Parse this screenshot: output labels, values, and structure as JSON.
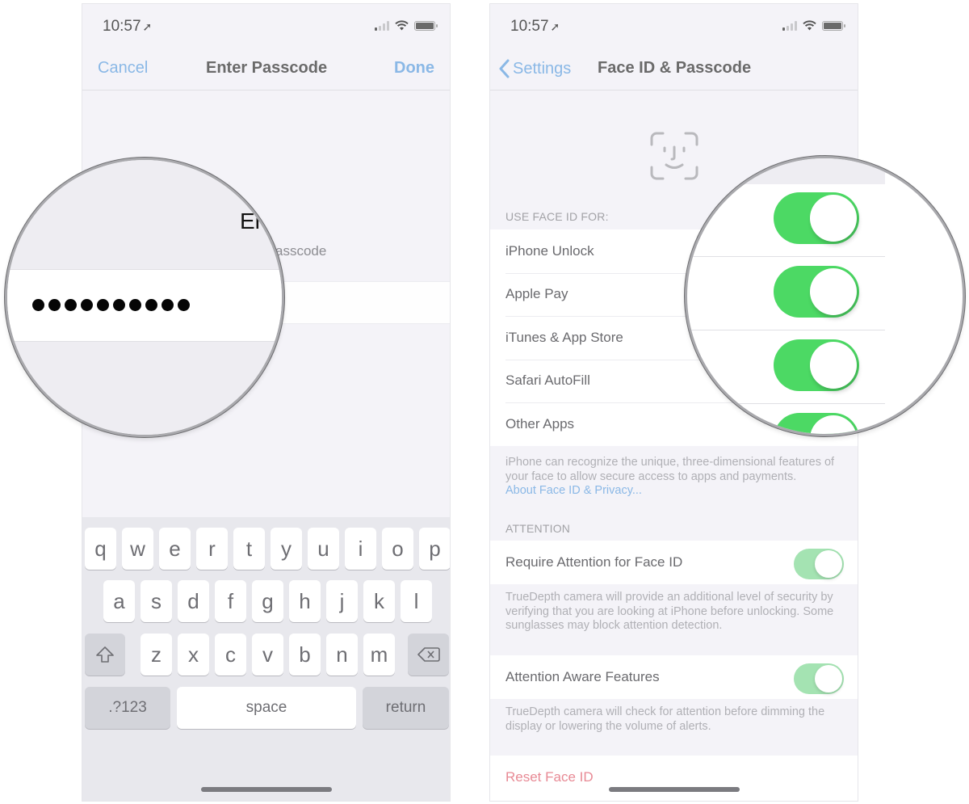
{
  "left_screen": {
    "status": {
      "time": "10:57",
      "location_icon": "location-arrow-icon",
      "signal_bars_on": 1,
      "signal_bars_total": 4,
      "wifi_icon": "wifi-icon",
      "battery_icon": "battery-icon"
    },
    "nav": {
      "cancel_label": "Cancel",
      "title": "Enter Passcode",
      "done_label": "Done"
    },
    "magnified_title_fragment": "Er",
    "passcode_hint_fragment": "asscode",
    "passcode_dots": 10,
    "keyboard": {
      "row1": [
        "q",
        "w",
        "e",
        "r",
        "t",
        "y",
        "u",
        "i",
        "o",
        "p"
      ],
      "row2": [
        "a",
        "s",
        "d",
        "f",
        "g",
        "h",
        "j",
        "k",
        "l"
      ],
      "row3": [
        "z",
        "x",
        "c",
        "v",
        "b",
        "n",
        "m"
      ],
      "shift_icon": "shift-icon",
      "delete_icon": "delete-backspace-icon",
      "numbers_label": ".?123",
      "space_label": "space",
      "return_label": "return"
    }
  },
  "right_screen": {
    "status": {
      "time": "10:57",
      "location_icon": "location-arrow-icon",
      "signal_bars_on": 1,
      "signal_bars_total": 4,
      "wifi_icon": "wifi-icon",
      "battery_icon": "battery-icon"
    },
    "nav": {
      "back_label": "Settings",
      "title": "Face ID & Passcode"
    },
    "faceid_icon": "face-id-icon",
    "use_face_id_header": "USE FACE ID FOR:",
    "use_face_id_items": [
      {
        "label": "iPhone Unlock",
        "enabled": true
      },
      {
        "label": "Apple Pay",
        "enabled": true
      },
      {
        "label": "iTunes & App Store",
        "enabled": true
      },
      {
        "label": "Safari AutoFill",
        "enabled": true
      },
      {
        "label": "Other Apps",
        "enabled": true
      }
    ],
    "face_id_footer": "iPhone can recognize the unique, three-dimensional features of your face to allow secure access to apps and payments.",
    "face_id_footer_link": "About Face ID & Privacy...",
    "attention_header": "ATTENTION",
    "require_attention": {
      "label": "Require Attention for Face ID",
      "enabled": true
    },
    "require_attention_footer": "TrueDepth camera will provide an additional level of security by verifying that you are looking at iPhone before unlocking. Some sunglasses may block attention detection.",
    "attention_aware": {
      "label": "Attention Aware Features",
      "enabled": true
    },
    "attention_aware_footer": "TrueDepth camera will check for attention before dimming the display or lowering the volume of alerts.",
    "reset_label": "Reset Face ID"
  },
  "colors": {
    "accent_blue": "#8ab8e6",
    "toggle_green": "#4cd964",
    "toggle_green_dimmed": "#a4e3b2",
    "destructive_red": "#e88a95",
    "grouped_background": "#f4f3f8"
  }
}
